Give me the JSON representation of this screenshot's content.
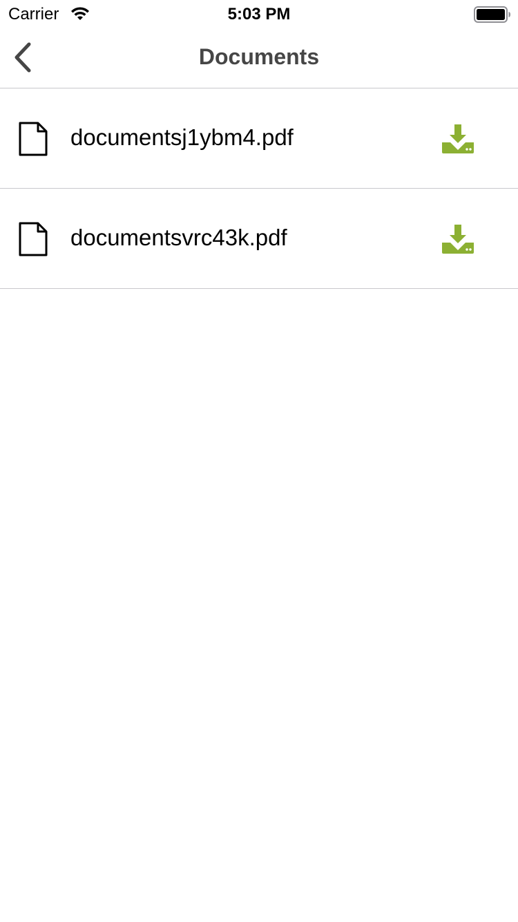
{
  "status_bar": {
    "carrier": "Carrier",
    "time": "5:03 PM",
    "icons": [
      "wifi-icon",
      "battery-icon"
    ]
  },
  "nav_bar": {
    "title": "Documents",
    "back_icon": "chevron-left-icon"
  },
  "documents": [
    {
      "name": "documentsj1ybm4.pdf",
      "icon": "file-icon",
      "action_icon": "download-icon"
    },
    {
      "name": "documentsvrc43k.pdf",
      "icon": "file-icon",
      "action_icon": "download-icon"
    }
  ],
  "colors": {
    "accent": "#8cb033",
    "title": "#464646",
    "separator": "#c8c7cc",
    "background": "#ffffff"
  }
}
